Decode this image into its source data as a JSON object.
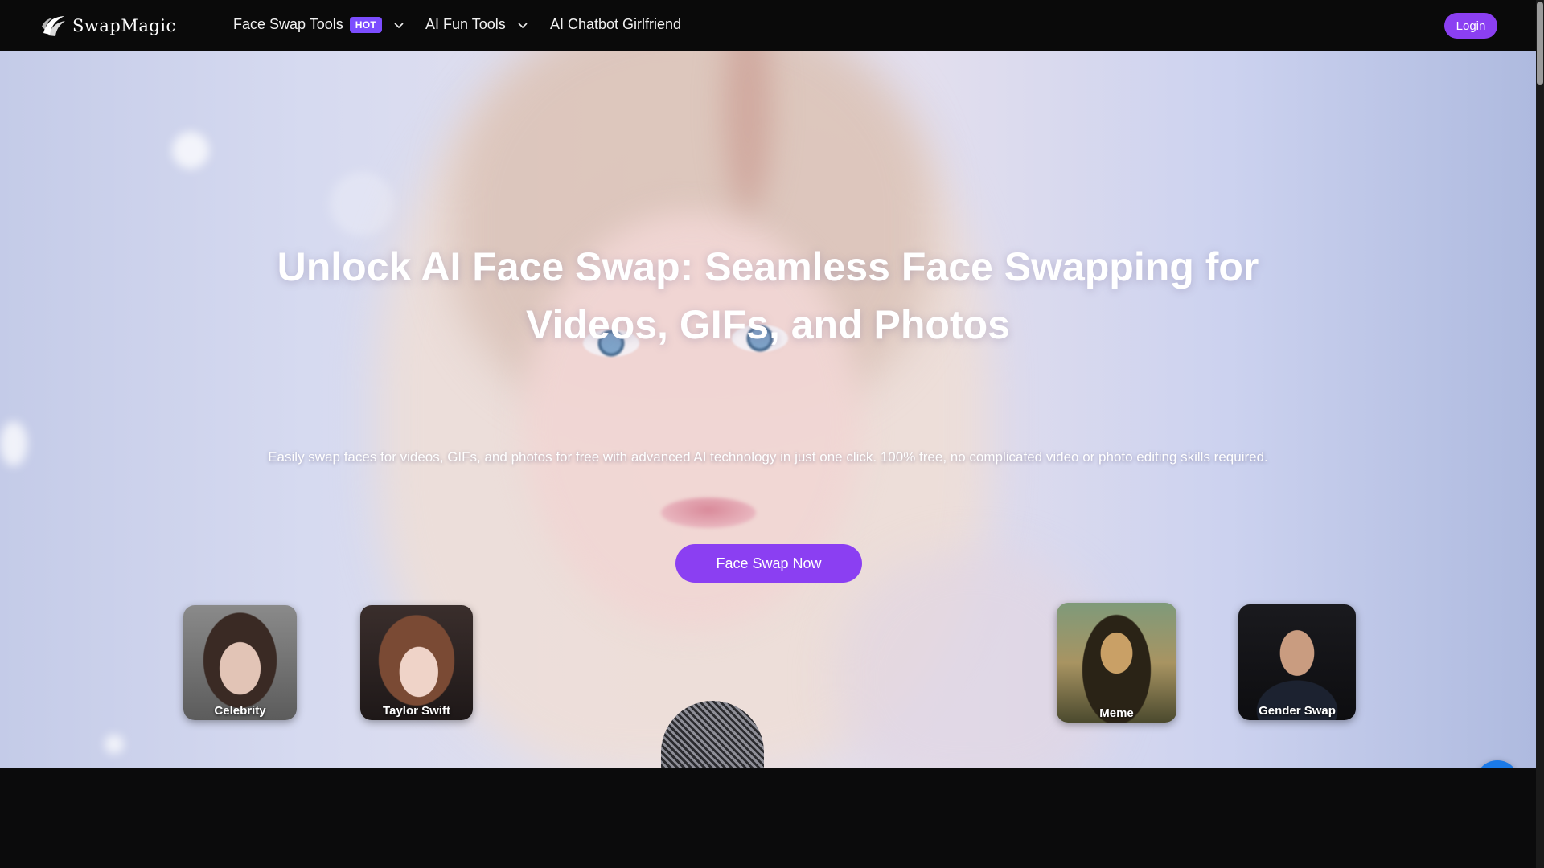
{
  "header": {
    "logo_text": "SwapMagic",
    "nav": [
      {
        "label": "Face Swap Tools",
        "badge": "HOT",
        "has_dropdown": true
      },
      {
        "label": "AI Fun Tools",
        "has_dropdown": true
      },
      {
        "label": "AI Chatbot Girlfriend",
        "has_dropdown": false
      }
    ],
    "login_label": "Login"
  },
  "hero": {
    "title": "Unlock AI Face Swap: Seamless Face Swapping for Videos, GIFs, and Photos",
    "subtitle": "Easily swap faces for videos, GIFs, and photos for free with advanced AI technology in just one click. 100% free, no complicated video or photo editing skills required.",
    "cta_label": "Face Swap Now"
  },
  "categories": [
    {
      "label": "Celebrity"
    },
    {
      "label": "Taylor Swift"
    },
    {
      "label": "Meme"
    },
    {
      "label": "Gender Swap"
    }
  ],
  "colors": {
    "accent": "#8b3ff2",
    "badge": "#7c4dff",
    "chat_widget": "#1b7ae8",
    "nav_bg": "#0a0a0a"
  },
  "icons": {
    "logo": "swapmagic-logo-icon",
    "dropdown": "chevron-down-icon",
    "chat": "chat-bubble-icon"
  }
}
